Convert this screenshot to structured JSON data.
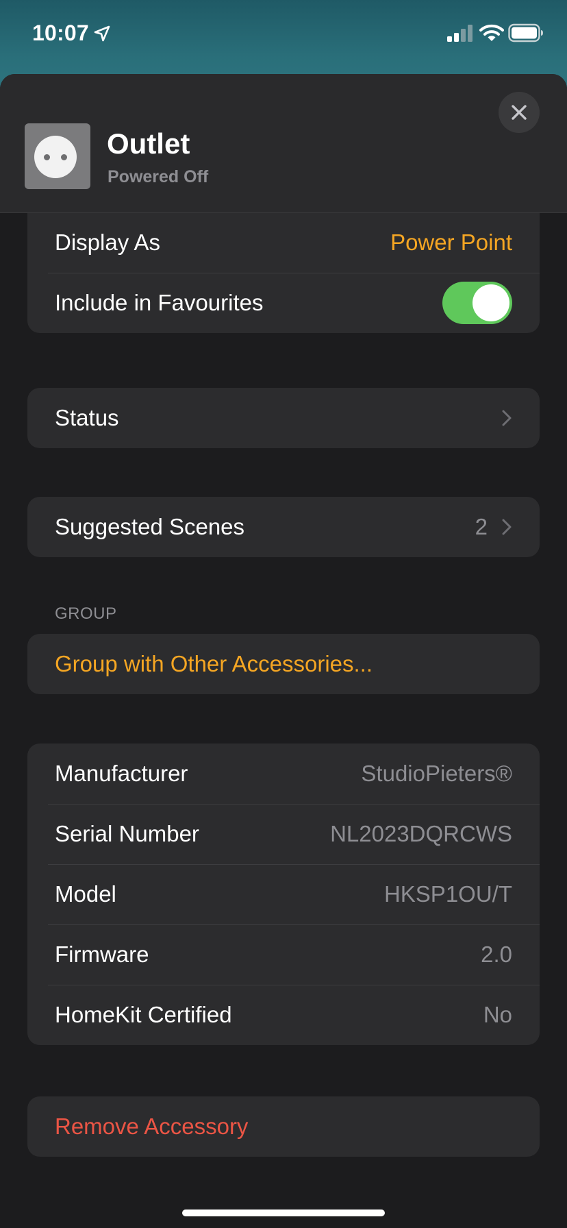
{
  "status_bar": {
    "time": "10:07",
    "location_icon": "location-arrow-icon",
    "signal_icon": "cellular-signal-icon",
    "wifi_icon": "wifi-icon",
    "battery_icon": "battery-icon"
  },
  "header": {
    "title": "Outlet",
    "subtitle": "Powered Off",
    "tile_icon": "outlet-icon",
    "close_icon": "close-icon"
  },
  "settings": {
    "display_as": {
      "label": "Display As",
      "value": "Power Point"
    },
    "favourites": {
      "label": "Include in Favourites",
      "enabled": true
    }
  },
  "status_row": {
    "label": "Status",
    "chevron_icon": "chevron-right-icon"
  },
  "scenes_row": {
    "label": "Suggested Scenes",
    "count": "2",
    "chevron_icon": "chevron-right-icon"
  },
  "group_section": {
    "header": "GROUP",
    "action": "Group with Other Accessories..."
  },
  "info": [
    {
      "label": "Manufacturer",
      "value": "StudioPieters®"
    },
    {
      "label": "Serial Number",
      "value": "NL2023DQRCWS"
    },
    {
      "label": "Model",
      "value": "HKSP1OU/T"
    },
    {
      "label": "Firmware",
      "value": "2.0"
    },
    {
      "label": "HomeKit Certified",
      "value": "No"
    }
  ],
  "remove": {
    "label": "Remove Accessory"
  },
  "colors": {
    "accent": "#f5a623",
    "danger": "#eb5545",
    "toggle_on": "#5fc85b",
    "background": "#1c1c1e",
    "cell": "#2c2c2e"
  }
}
